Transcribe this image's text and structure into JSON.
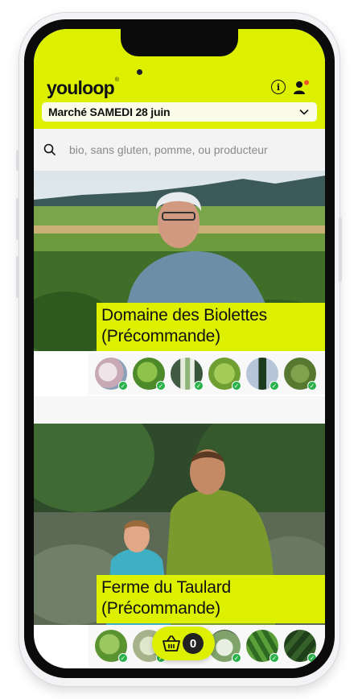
{
  "app": {
    "logo": "youloop",
    "logo_mark": "®",
    "accent": "#dcf000"
  },
  "header": {
    "market_select": "Marché SAMEDI 28 juin",
    "info_icon": "info-circle-icon",
    "user_icon": "user-icon",
    "user_notification_color": "#f2552c"
  },
  "search": {
    "placeholder": "bio, sans gluten, pomme, ou producteur",
    "icon": "search-icon"
  },
  "producers": [
    {
      "title_line1": "Domaine des Biolettes",
      "title_line2": "(Précommande)",
      "products": [
        "garlic",
        "lettuce",
        "leek",
        "salad",
        "oil-bottle",
        "herbs"
      ]
    },
    {
      "title_line1": "Ferme du Taulard",
      "title_line2": "(Précommande)",
      "products": [
        "lettuce",
        "cabbage",
        "kohlrabi",
        "zucchini",
        "cucumber"
      ]
    }
  ],
  "cart": {
    "icon": "basket-icon",
    "count": "0"
  }
}
